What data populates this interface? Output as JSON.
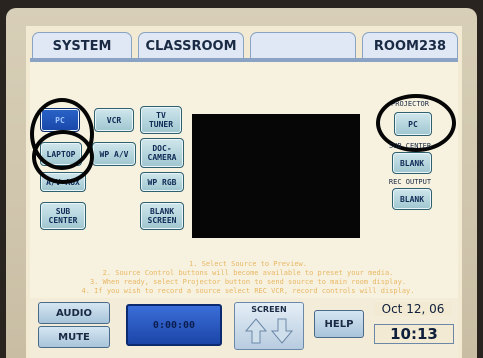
{
  "tabs": {
    "system": "SYSTEM",
    "classroom": "CLASSROOM",
    "blank": "",
    "room": "ROOM238"
  },
  "sources": {
    "pc": "PC",
    "vcr": "VCR",
    "tv_tuner": "TV\nTUNER",
    "laptop": "LAPTOP",
    "wp_av": "WP A/V",
    "doc_camera": "DOC-\nCAMERA",
    "av_aux": "A/V AUX",
    "wp_rgb": "WP RGB",
    "sub_center": "SUB\nCENTER",
    "blank_screen": "BLANK\nSCREEN"
  },
  "outputs": {
    "projector_label": "PROJECTOR",
    "projector_btn": "PC",
    "sub_center_label": "SUB CENTER",
    "sub_center_btn": "BLANK",
    "rec_output_label": "REC OUTPUT",
    "rec_output_btn": "BLANK"
  },
  "instructions": [
    "1. Select Source to Preview.",
    "2. Source Control buttons will become available to preset your media.",
    "3. When ready, select Projector button to send source to main room display.",
    "4. If you wish to record a source select REC VCR, record controls will display."
  ],
  "bottom": {
    "audio": "AUDIO",
    "mute": "MUTE",
    "timer": "0:00:00",
    "screen_label": "SCREEN",
    "help": "HELP",
    "date": "Oct 12, 06",
    "time": "10:13"
  },
  "colors": {
    "active_button": "#1947a8",
    "instruction_text": "#e8b865",
    "button_face": "#9fc6d0"
  }
}
